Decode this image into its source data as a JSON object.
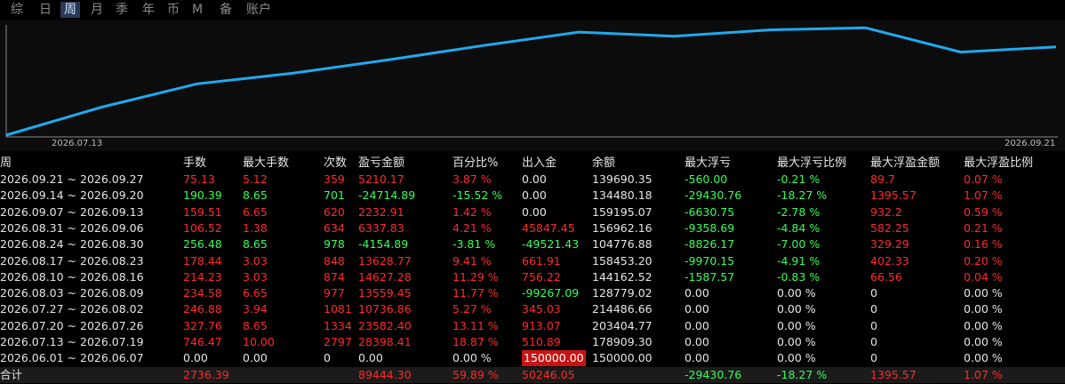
{
  "tabs": [
    "综",
    "日",
    "周",
    "月",
    "季",
    "年",
    "币",
    "M",
    "备",
    "账户"
  ],
  "active_tab_index": 2,
  "colors": {
    "positive": "#ff2a2a",
    "negative": "#32ff5a",
    "line": "#1eaaf0",
    "neutral": "#e6e6e6"
  },
  "chart_data": {
    "type": "line",
    "x_tick_labels": [
      "2026.07.13",
      "2026.09.21"
    ],
    "x": [
      "2026.06.01 ~ 2026.06.07",
      "2026.07.13 ~ 2026.07.19",
      "2026.07.20 ~ 2026.07.26",
      "2026.07.27 ~ 2026.08.02",
      "2026.08.03 ~ 2026.08.09",
      "2026.08.10 ~ 2026.08.16",
      "2026.08.17 ~ 2026.08.23",
      "2026.08.24 ~ 2026.08.30",
      "2026.08.31 ~ 2026.09.06",
      "2026.09.07 ~ 2026.09.13",
      "2026.09.14 ~ 2026.09.20",
      "2026.09.21 ~ 2026.09.27"
    ],
    "series": [
      {
        "name": "",
        "values": [
          150000,
          178398.41,
          201980.81,
          212717.67,
          226277.12,
          240904.4,
          254533.17,
          250378.28,
          256715.11,
          258948.02,
          234233.13,
          239443.3
        ]
      }
    ],
    "ylim": [
      150000,
      260000
    ]
  },
  "columns": [
    "周",
    "手数",
    "最大手数",
    "次数",
    "盈亏金额",
    "百分比%",
    "出入金",
    "余额",
    "最大浮亏",
    "最大浮亏比例",
    "最大浮盈金额",
    "最大浮盈比例"
  ],
  "rows": [
    [
      "2026.09.21 ~ 2026.09.27",
      "75.13",
      "5.12",
      "359",
      "5210.17",
      "3.87 %",
      "0.00",
      "139690.35",
      "-560.00",
      "-0.21 %",
      "89.7",
      "0.07 %"
    ],
    [
      "2026.09.14 ~ 2026.09.20",
      "190.39",
      "8.65",
      "701",
      "-24714.89",
      "-15.52 %",
      "0.00",
      "134480.18",
      "-29430.76",
      "-18.27 %",
      "1395.57",
      "1.07 %"
    ],
    [
      "2026.09.07 ~ 2026.09.13",
      "159.51",
      "6.65",
      "620",
      "2232.91",
      "1.42 %",
      "0.00",
      "159195.07",
      "-6630.75",
      "-2.78 %",
      "932.2",
      "0.59 %"
    ],
    [
      "2026.08.31 ~ 2026.09.06",
      "106.52",
      "1.38",
      "634",
      "6337.83",
      "4.21 %",
      "45847.45",
      "156962.16",
      "-9358.69",
      "-4.84 %",
      "582.25",
      "0.21 %"
    ],
    [
      "2026.08.24 ~ 2026.08.30",
      "256.48",
      "8.65",
      "978",
      "-4154.89",
      "-3.81 %",
      "-49521.43",
      "104776.88",
      "-8826.17",
      "-7.00 %",
      "329.29",
      "0.16 %"
    ],
    [
      "2026.08.17 ~ 2026.08.23",
      "178.44",
      "3.03",
      "848",
      "13628.77",
      "9.41 %",
      "661.91",
      "158453.20",
      "-9970.15",
      "-4.91 %",
      "402.33",
      "0.20 %"
    ],
    [
      "2026.08.10 ~ 2026.08.16",
      "214.23",
      "3.03",
      "874",
      "14627.28",
      "11.29 %",
      "756.22",
      "144162.52",
      "-1587.57",
      "-0.83 %",
      "66.56",
      "0.04 %"
    ],
    [
      "2026.08.03 ~ 2026.08.09",
      "234.58",
      "6.65",
      "977",
      "13559.45",
      "11.77 %",
      "-99267.09",
      "128779.02",
      "0.00",
      "0.00 %",
      "0",
      "0.00 %"
    ],
    [
      "2026.07.27 ~ 2026.08.02",
      "246.88",
      "3.94",
      "1081",
      "10736.86",
      "5.27 %",
      "345.03",
      "214486.66",
      "0.00",
      "0.00 %",
      "0",
      "0.00 %"
    ],
    [
      "2026.07.20 ~ 2026.07.26",
      "327.76",
      "8.65",
      "1334",
      "23582.40",
      "13.11 %",
      "913.07",
      "203404.77",
      "0.00",
      "0.00 %",
      "0",
      "0.00 %"
    ],
    [
      "2026.07.13 ~ 2026.07.19",
      "746.47",
      "10.00",
      "2797",
      "28398.41",
      "18.87 %",
      "510.89",
      "178909.30",
      "0.00",
      "0.00 %",
      "0",
      "0.00 %"
    ],
    [
      "2026.06.01 ~ 2026.06.07",
      "0.00",
      "0.00",
      "0",
      "0.00",
      "0.00 %",
      "150000.00",
      "150000.00",
      "0.00",
      "0.00 %",
      "0",
      "0.00 %"
    ]
  ],
  "row_colors": [
    [
      "w",
      "r",
      "r",
      "r",
      "r",
      "r",
      "w",
      "w",
      "g",
      "g",
      "r",
      "r"
    ],
    [
      "w",
      "g",
      "g",
      "g",
      "g",
      "g",
      "w",
      "w",
      "g",
      "g",
      "r",
      "r"
    ],
    [
      "w",
      "r",
      "r",
      "r",
      "r",
      "r",
      "w",
      "w",
      "g",
      "g",
      "r",
      "r"
    ],
    [
      "w",
      "r",
      "r",
      "r",
      "r",
      "r",
      "r",
      "w",
      "g",
      "g",
      "r",
      "r"
    ],
    [
      "w",
      "g",
      "g",
      "g",
      "g",
      "g",
      "g",
      "w",
      "g",
      "g",
      "r",
      "r"
    ],
    [
      "w",
      "r",
      "r",
      "r",
      "r",
      "r",
      "r",
      "w",
      "g",
      "g",
      "r",
      "r"
    ],
    [
      "w",
      "r",
      "r",
      "r",
      "r",
      "r",
      "r",
      "w",
      "g",
      "g",
      "r",
      "r"
    ],
    [
      "w",
      "r",
      "r",
      "r",
      "r",
      "r",
      "g",
      "w",
      "w",
      "w",
      "w",
      "w"
    ],
    [
      "w",
      "r",
      "r",
      "r",
      "r",
      "r",
      "r",
      "w",
      "w",
      "w",
      "w",
      "w"
    ],
    [
      "w",
      "r",
      "r",
      "r",
      "r",
      "r",
      "r",
      "w",
      "w",
      "w",
      "w",
      "w"
    ],
    [
      "w",
      "r",
      "r",
      "r",
      "r",
      "r",
      "r",
      "w",
      "w",
      "w",
      "w",
      "w"
    ],
    [
      "w",
      "w",
      "w",
      "w",
      "w",
      "w",
      "sel",
      "w",
      "w",
      "w",
      "w",
      "w"
    ]
  ],
  "total": {
    "label": "合计",
    "lots": "2736.39",
    "pnl": "89444.30",
    "pct": "59.89 %",
    "cash": "50246.05",
    "max_float_loss": "-29430.76",
    "max_float_loss_pct": "-18.27 %",
    "max_float_profit": "1395.57",
    "max_float_profit_pct": "1.07 %"
  }
}
